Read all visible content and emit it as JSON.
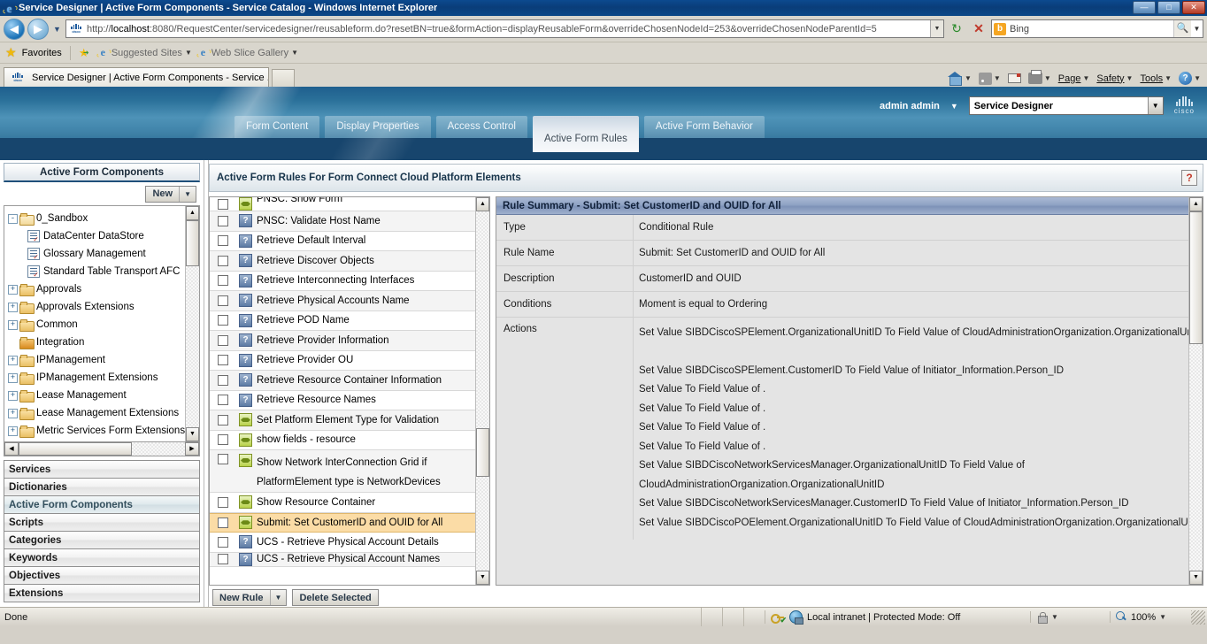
{
  "window": {
    "title": "Service Designer | Active Form Components - Service Catalog - Windows Internet Explorer",
    "minimize": "—",
    "maximize": "□",
    "close": "✕"
  },
  "address_bar": {
    "back_icon": "◀",
    "forward_icon": "▶",
    "history_caret": "▼",
    "url_protocol": "http://",
    "url_host": "localhost",
    "url_rest": ":8080/RequestCenter/servicedesigner/reusableform.do?resetBN=true&formAction=displayReusableForm&overrideChosenNodeId=253&overrideChosenNodeParentId=5",
    "url_dropdown": "▼",
    "refresh_label": "↻",
    "stop_label": "✕",
    "search_engine": "b",
    "search_value": "Bing",
    "search_go": "🔍",
    "search_caret": "▼"
  },
  "favorites_bar": {
    "favorites_label": "Favorites",
    "items": [
      {
        "label": "Suggested Sites",
        "caret": "▼"
      },
      {
        "label": "Web Slice Gallery",
        "caret": "▼"
      }
    ]
  },
  "browser_tabs": {
    "active_tab": "Service Designer | Active Form Components - Service ...",
    "new_tab": ""
  },
  "command_bar": {
    "home_caret": "▼",
    "feeds_caret": "▼",
    "print_caret": "▼",
    "page": "Page",
    "page_caret": "▼",
    "safety": "Safety",
    "safety_caret": "▼",
    "tools": "Tools",
    "tools_caret": "▼",
    "help": "?",
    "help_caret": "▼"
  },
  "app_header": {
    "user_name": "admin admin",
    "user_caret": "▼",
    "module_selected": "Service Designer",
    "module_caret": "▼",
    "brand": "cisco",
    "tabs": [
      {
        "label": "Form Content",
        "active": false
      },
      {
        "label": "Display Properties",
        "active": false
      },
      {
        "label": "Access Control",
        "active": false
      },
      {
        "label": "Active Form Rules",
        "active": true
      },
      {
        "label": "Active Form Behavior",
        "active": false
      }
    ]
  },
  "sidebar": {
    "title": "Active Form Components",
    "new_button": {
      "label": "New",
      "caret": "▼"
    },
    "tree": [
      {
        "label": "0_Sandbox",
        "kind": "folder-open",
        "expander": "-",
        "indent": 0
      },
      {
        "label": "DataCenter DataStore",
        "kind": "doc",
        "expander": "",
        "indent": 1
      },
      {
        "label": "Glossary Management",
        "kind": "doc",
        "expander": "",
        "indent": 1
      },
      {
        "label": "Standard Table Transport AFC",
        "kind": "doc",
        "expander": "",
        "indent": 1
      },
      {
        "label": "Approvals",
        "kind": "folder",
        "expander": "+",
        "indent": 0
      },
      {
        "label": "Approvals Extensions",
        "kind": "folder",
        "expander": "+",
        "indent": 0
      },
      {
        "label": "Common",
        "kind": "folder",
        "expander": "+",
        "indent": 0
      },
      {
        "label": "Integration",
        "kind": "folder-special",
        "expander": "",
        "indent": 0
      },
      {
        "label": "IPManagement",
        "kind": "folder",
        "expander": "+",
        "indent": 0
      },
      {
        "label": "IPManagement Extensions",
        "kind": "folder",
        "expander": "+",
        "indent": 0
      },
      {
        "label": "Lease Management",
        "kind": "folder",
        "expander": "+",
        "indent": 0
      },
      {
        "label": "Lease Management Extensions",
        "kind": "folder",
        "expander": "+",
        "indent": 0
      },
      {
        "label": "Metric Services Form Extensions",
        "kind": "folder",
        "expander": "+",
        "indent": 0
      }
    ],
    "scroll_up": "▲",
    "scroll_down": "▼",
    "scroll_left": "◀",
    "scroll_right": "▶",
    "accordion": [
      {
        "label": "Services",
        "current": false
      },
      {
        "label": "Dictionaries",
        "current": false
      },
      {
        "label": "Active Form Components",
        "current": true
      },
      {
        "label": "Scripts",
        "current": false
      },
      {
        "label": "Categories",
        "current": false
      },
      {
        "label": "Keywords",
        "current": false
      },
      {
        "label": "Objectives",
        "current": false
      },
      {
        "label": "Extensions",
        "current": false
      }
    ]
  },
  "content": {
    "title": "Active Form Rules For Form Connect Cloud Platform Elements",
    "help": "?",
    "rules": [
      {
        "label": "PNSC: Show Form",
        "icon": "green-rule-icon",
        "selected": false,
        "clipped": true
      },
      {
        "label": "PNSC: Validate Host Name",
        "icon": "blue-question-icon",
        "selected": false
      },
      {
        "label": "Retrieve Default Interval",
        "icon": "blue-question-icon",
        "selected": false
      },
      {
        "label": "Retrieve Discover Objects",
        "icon": "blue-question-icon",
        "selected": false
      },
      {
        "label": "Retrieve Interconnecting Interfaces",
        "icon": "blue-question-icon",
        "selected": false
      },
      {
        "label": "Retrieve Physical Accounts Name",
        "icon": "blue-question-icon",
        "selected": false
      },
      {
        "label": "Retrieve POD Name",
        "icon": "blue-question-icon",
        "selected": false
      },
      {
        "label": "Retrieve Provider Information",
        "icon": "blue-question-icon",
        "selected": false
      },
      {
        "label": "Retrieve Provider OU",
        "icon": "blue-question-icon",
        "selected": false
      },
      {
        "label": "Retrieve Resource Container Information",
        "icon": "blue-question-icon",
        "selected": false
      },
      {
        "label": "Retrieve Resource Names",
        "icon": "blue-question-icon",
        "selected": false
      },
      {
        "label": "Set Platform Element Type for Validation",
        "icon": "green-rule-icon",
        "selected": false
      },
      {
        "label": "show fields - resource",
        "icon": "green-rule-icon",
        "selected": false
      },
      {
        "label": "Show Network InterConnection Grid if PlatformElement type is NetworkDevices",
        "icon": "green-rule-icon",
        "selected": false,
        "twoline": true
      },
      {
        "label": "Show Resource Container",
        "icon": "green-rule-icon",
        "selected": false
      },
      {
        "label": "Submit: Set CustomerID and OUID for All",
        "icon": "green-rule-icon",
        "selected": true
      },
      {
        "label": "UCS - Retrieve Physical Account Details",
        "icon": "blue-question-icon",
        "selected": false
      },
      {
        "label": "UCS - Retrieve Physical Account Names",
        "icon": "blue-question-icon",
        "selected": false,
        "clipped": true
      }
    ],
    "list_scroll_up": "▲",
    "list_scroll_down": "▼",
    "summary": {
      "header": "Rule Summary - Submit: Set CustomerID and OUID for All",
      "fields": [
        {
          "label": "Type",
          "value": "Conditional Rule"
        },
        {
          "label": "Rule Name",
          "value": "Submit: Set CustomerID and OUID for All"
        },
        {
          "label": "Description",
          "value": "CustomerID and OUID"
        },
        {
          "label": "Conditions",
          "value": "Moment is equal to Ordering"
        }
      ],
      "actions_label": "Actions",
      "actions": [
        "Set Value SIBDCiscoSPElement.OrganizationalUnitID To Field Value of CloudAdministrationOrganization.OrganizationalUnitID",
        "",
        "Set Value SIBDCiscoSPElement.CustomerID To Field Value of Initiator_Information.Person_ID",
        "Set Value To Field Value of .",
        "Set Value To Field Value of .",
        "Set Value To Field Value of .",
        "Set Value To Field Value of .",
        "Set Value SIBDCiscoNetworkServicesManager.OrganizationalUnitID To Field Value of",
        "CloudAdministrationOrganization.OrganizationalUnitID",
        "Set Value SIBDCiscoNetworkServicesManager.CustomerID To Field Value of Initiator_Information.Person_ID",
        "Set Value SIBDCiscoPOElement.OrganizationalUnitID To Field Value of CloudAdministrationOrganization.OrganizationalUnitID"
      ],
      "scroll_up": "▲",
      "scroll_down": "▼"
    },
    "footer": {
      "new_rule": "New Rule",
      "new_rule_caret": "▼",
      "delete_selected": "Delete Selected"
    }
  },
  "status_bar": {
    "message": "Done",
    "zone": "Local intranet | Protected Mode: Off",
    "protected_caret": "▼",
    "zoom": "100%",
    "zoom_caret": "▼"
  },
  "colors": {
    "title_blue": "#0b4787",
    "banner_blue": "#2a7099",
    "banner_dark": "#17456d",
    "selected_row": "#fbdca6",
    "summary_header": "#8fa3c4"
  }
}
